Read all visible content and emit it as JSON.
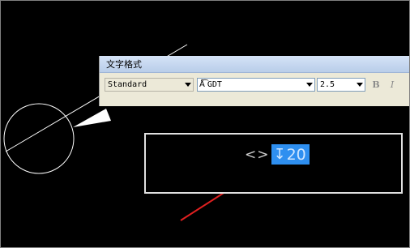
{
  "toolbar": {
    "title": "文字格式",
    "text_style": "Standard",
    "font_icon": "truetype-font-icon",
    "font_name": "GDT",
    "text_height": "2.5",
    "bold_label": "B",
    "italic_label": "I"
  },
  "editor": {
    "placeholder_text": "<>",
    "depth_symbol": "↧",
    "selected_value": "20",
    "selection_color": "#2e8ff0"
  },
  "icons": {
    "style_dropdown": "chevron-down-icon",
    "font_dropdown": "chevron-down-icon",
    "height_dropdown": "chevron-down-icon"
  },
  "colors": {
    "canvas": "#000000",
    "drawing_lines": "#ffffff",
    "annotation_arrow": "#e02020"
  }
}
